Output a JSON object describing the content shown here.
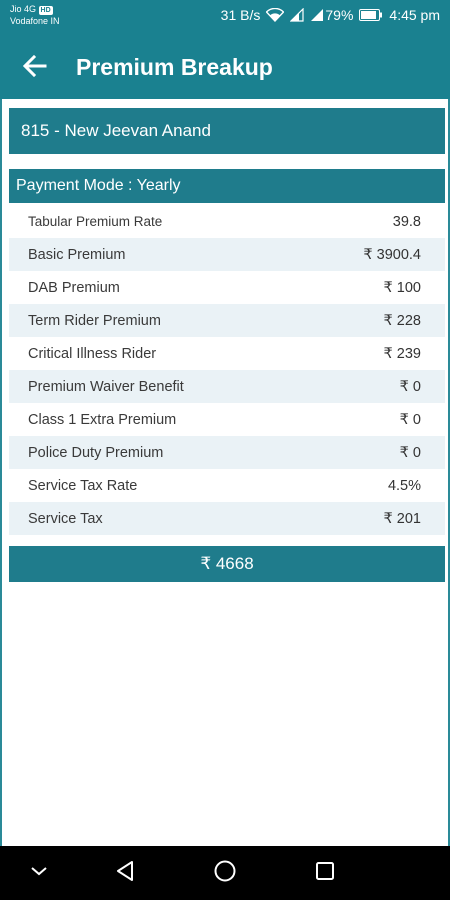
{
  "status_bar": {
    "carrier_line1": "Jio 4G",
    "volte_badge": "HD",
    "carrier_line2": "Vodafone IN",
    "net_speed": "31 B/s",
    "battery_percent": "79%",
    "time": "4:45 pm",
    "icons": [
      "wifi-icon",
      "signal-icon",
      "signal-icon",
      "battery-icon"
    ]
  },
  "header": {
    "title": "Premium Breakup",
    "back_icon": "arrow-left-icon"
  },
  "plan": {
    "name": "815 - New Jeevan Anand"
  },
  "payment_mode": {
    "label": "Payment Mode : Yearly"
  },
  "breakup": [
    {
      "label": "Tabular Premium Rate",
      "value": "39.8"
    },
    {
      "label": "Basic Premium",
      "value": "₹ 3900.4"
    },
    {
      "label": "DAB Premium",
      "value": "₹ 100"
    },
    {
      "label": "Term Rider Premium",
      "value": "₹ 228"
    },
    {
      "label": "Critical Illness Rider",
      "value": "₹ 239"
    },
    {
      "label": "Premium Waiver Benefit",
      "value": "₹ 0"
    },
    {
      "label": "Class 1 Extra Premium",
      "value": "₹ 0"
    },
    {
      "label": "Police Duty Premium",
      "value": "₹ 0"
    },
    {
      "label": "Service Tax Rate",
      "value": "4.5%"
    },
    {
      "label": "Service Tax",
      "value": "₹ 201"
    }
  ],
  "total": {
    "value": "₹ 4668"
  },
  "navigation": {
    "icons": [
      "chevron-down-icon",
      "back-triangle-icon",
      "home-circle-icon",
      "recents-square-icon"
    ]
  },
  "colors": {
    "primary": "#1a8190",
    "bar": "#1f7c8c",
    "row_alt": "#eaf2f6"
  }
}
